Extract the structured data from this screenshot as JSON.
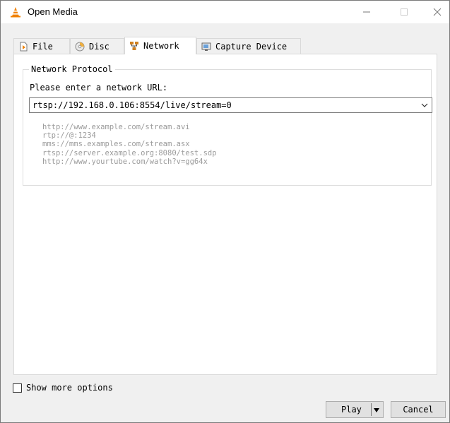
{
  "window": {
    "title": "Open Media",
    "controls": {
      "minimize_icon": "minimize-icon",
      "maximize_icon": "maximize-icon",
      "close_icon": "close-icon"
    }
  },
  "tabs": [
    {
      "label": "File",
      "icon": "file-icon",
      "active": false
    },
    {
      "label": "Disc",
      "icon": "disc-icon",
      "active": false
    },
    {
      "label": "Network",
      "icon": "network-icon",
      "active": true
    },
    {
      "label": "Capture Device",
      "icon": "capture-device-icon",
      "active": false
    }
  ],
  "network": {
    "group_title": "Network Protocol",
    "url_label": "Please enter a network URL:",
    "url_value": "rtsp://192.168.0.106:8554/live/stream=0",
    "examples": [
      "http://www.example.com/stream.avi",
      "rtp://@:1234",
      "mms://mms.examples.com/stream.asx",
      "rtsp://server.example.org:8080/test.sdp",
      "http://www.yourtube.com/watch?v=gg64x"
    ]
  },
  "footer": {
    "show_more_label": "Show more options",
    "show_more_checked": false,
    "play_label": "Play",
    "cancel_label": "Cancel"
  },
  "colors": {
    "accent_orange": "#f08000",
    "example_text": "#9b9b9b"
  }
}
